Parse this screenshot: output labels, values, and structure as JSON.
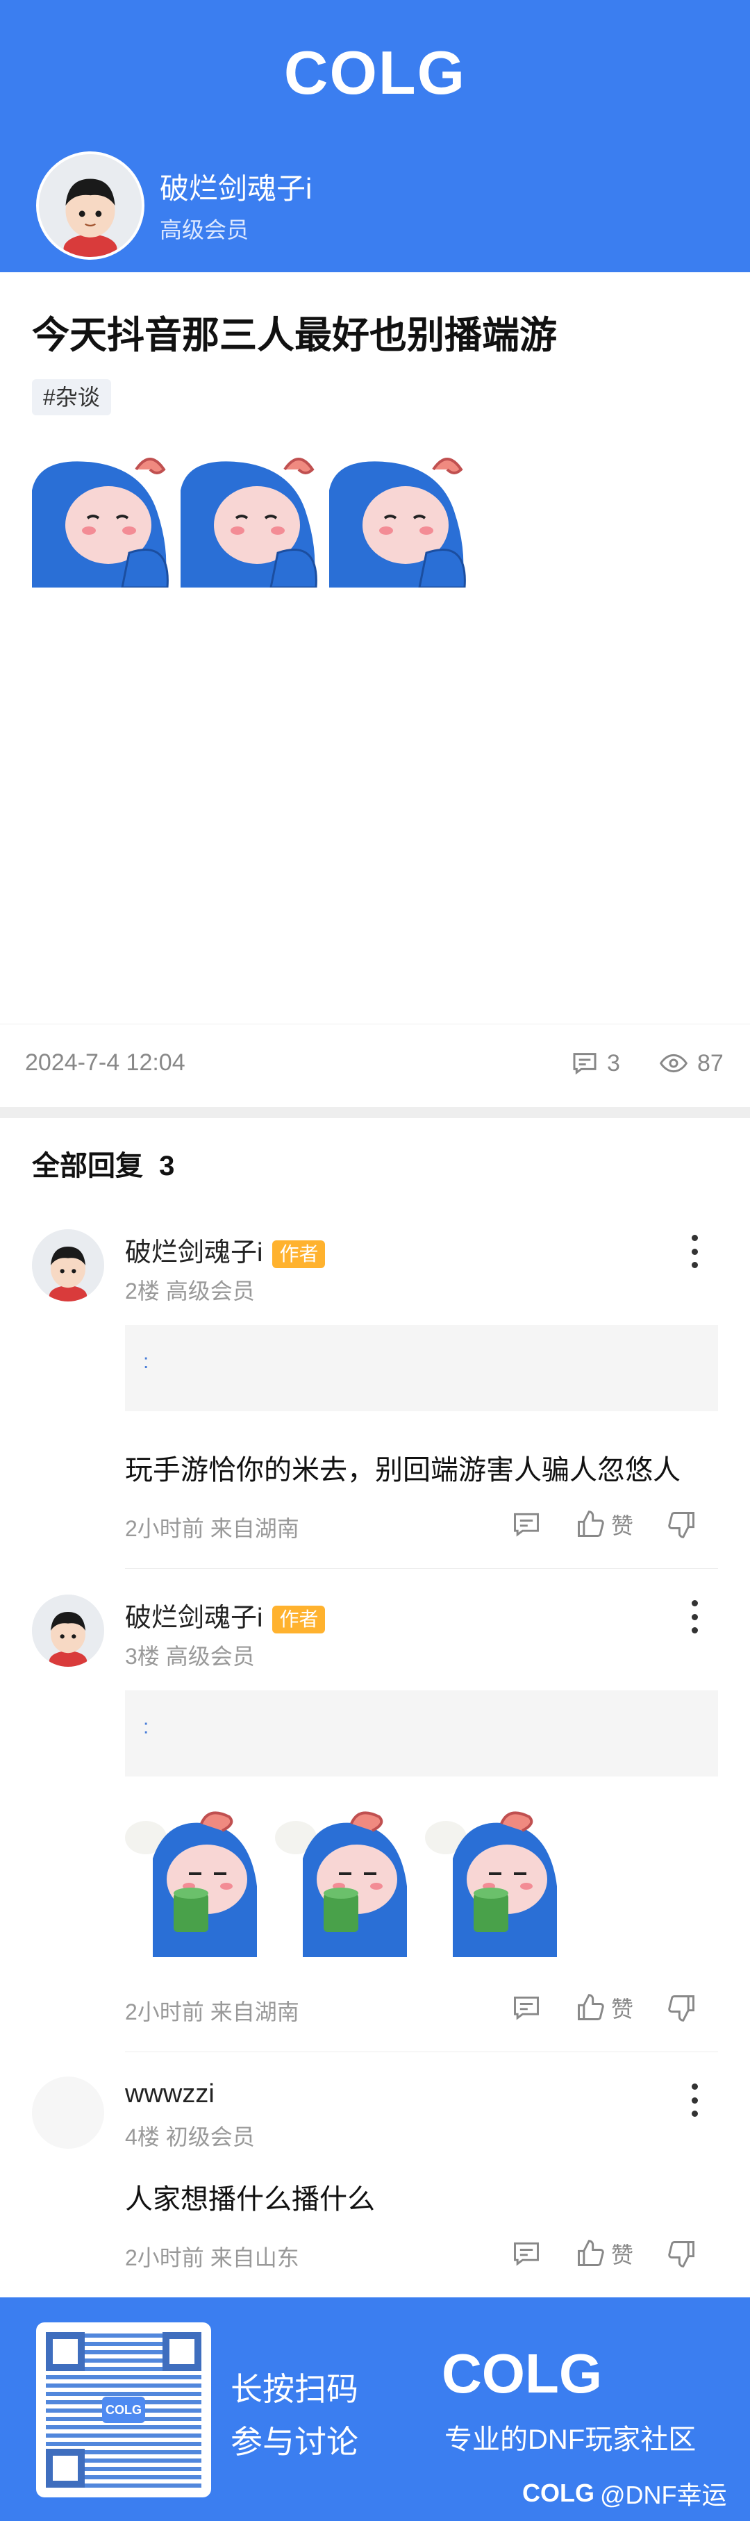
{
  "header": {
    "logo": "COLG",
    "author_name": "破烂剑魂子i",
    "author_level": "高级会员"
  },
  "post": {
    "title": "今天抖音那三人最好也别播端游",
    "tag": "#杂谈",
    "date": "2024-7-4 12:04",
    "comment_count": "3",
    "view_count": "87"
  },
  "replies_title": "全部回复",
  "replies_count": "3",
  "author_badge": "作者",
  "like_label": "赞",
  "replies": [
    {
      "name": "破烂剑魂子i",
      "floor_level": "2楼 高级会员",
      "quote": ":",
      "text": "玩手游恰你的米去，别回端游害人骗人忽悠人",
      "footer": "2小时前 来自湖南"
    },
    {
      "name": "破烂剑魂子i",
      "floor_level": "3楼 高级会员",
      "quote": ":",
      "footer": "2小时前 来自湖南"
    },
    {
      "name": "wwwzzi",
      "floor_level": "4楼 初级会员",
      "text": "人家想播什么播什么",
      "footer": "2小时前 来自山东"
    }
  ],
  "footer": {
    "scan_line1": "长按扫码",
    "scan_line2": "参与讨论",
    "logo": "COLG",
    "slogan": "专业的DNF玩家社区",
    "brand_logo": "COLG",
    "brand_text": "@DNF幸运"
  },
  "colors": {
    "brand_blue": "#3b7ef0",
    "author_badge": "#ffb22e"
  }
}
